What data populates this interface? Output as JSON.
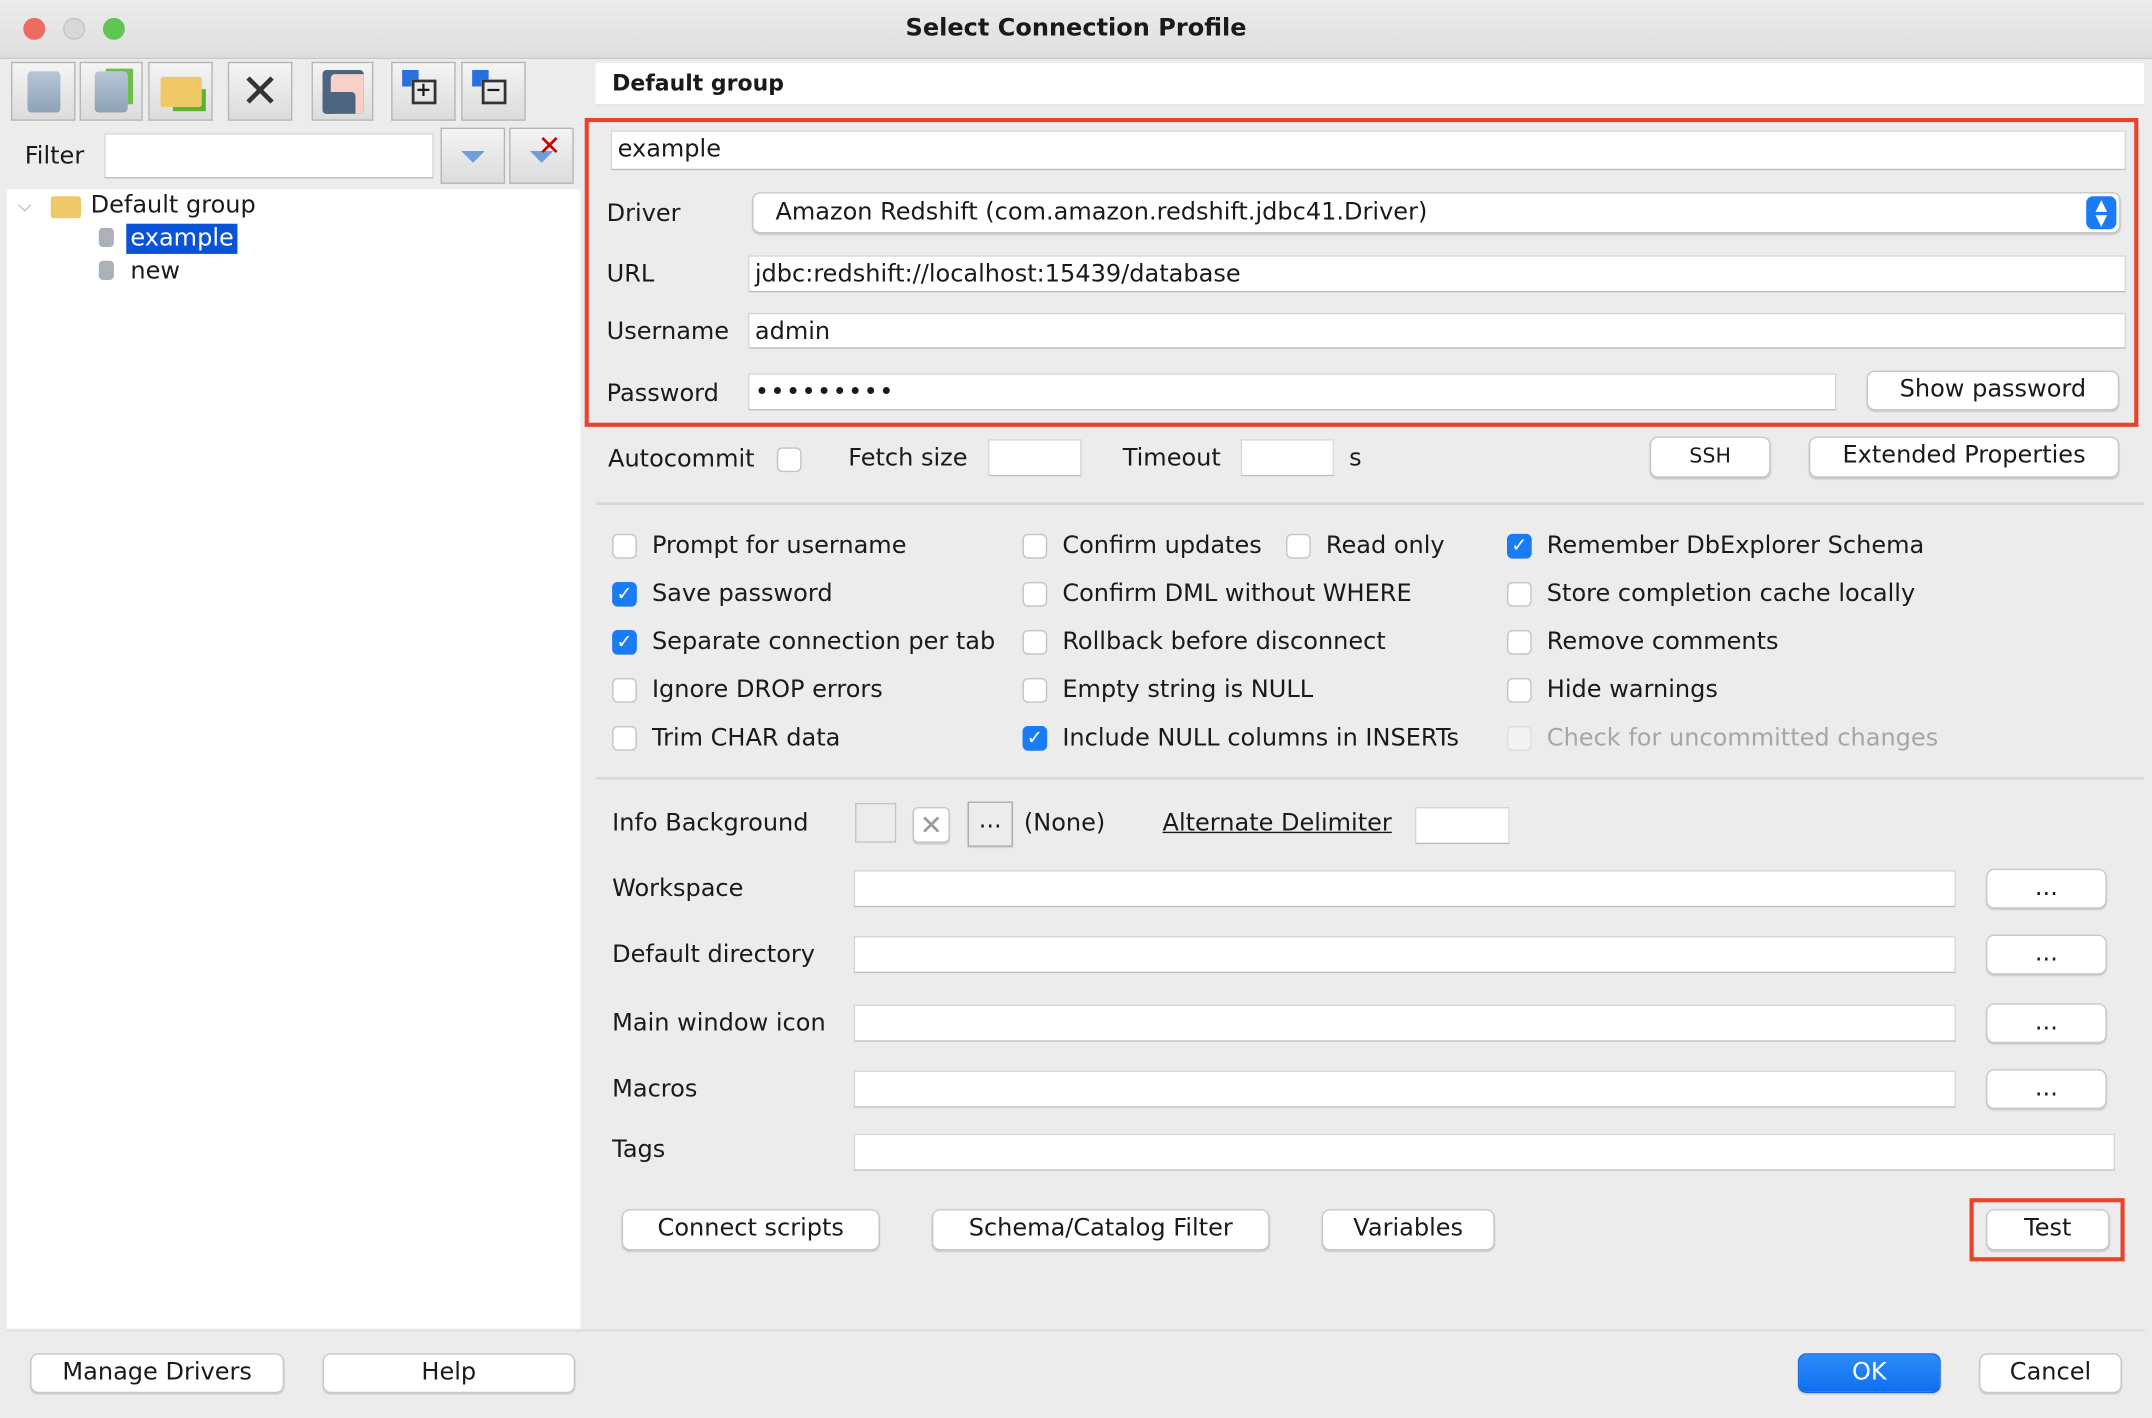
{
  "window": {
    "title": "Select Connection Profile"
  },
  "sidebar": {
    "filter_label": "Filter",
    "filter_value": "",
    "tree": {
      "group": "Default group",
      "items": [
        {
          "label": "example",
          "selected": true
        },
        {
          "label": "new",
          "selected": false
        }
      ]
    },
    "toolbar_icons": [
      "new-profile-icon",
      "copy-profile-icon",
      "new-folder-icon",
      "delete-icon",
      "save-icon",
      "expand-tree-icon",
      "collapse-tree-icon"
    ]
  },
  "header": {
    "group_title": "Default group"
  },
  "profile": {
    "name": "example",
    "driver_label": "Driver",
    "driver_value": "Amazon Redshift (com.amazon.redshift.jdbc41.Driver)",
    "url_label": "URL",
    "url_value": "jdbc:redshift://localhost:15439/database",
    "username_label": "Username",
    "username_value": "admin",
    "password_label": "Password",
    "password_value": "•••••••••",
    "show_password": "Show password"
  },
  "options": {
    "autocommit": "Autocommit",
    "fetch_size": "Fetch size",
    "timeout": "Timeout",
    "timeout_unit": "s",
    "ssh": "SSH",
    "extended_properties": "Extended Properties"
  },
  "checkboxes": [
    {
      "label": "Prompt for username",
      "checked": false
    },
    {
      "label": "Save password",
      "checked": true
    },
    {
      "label": "Separate connection per tab",
      "checked": true
    },
    {
      "label": "Ignore DROP errors",
      "checked": false
    },
    {
      "label": "Trim CHAR data",
      "checked": false
    },
    {
      "label": "Confirm updates",
      "checked": false
    },
    {
      "label": "Confirm DML without WHERE",
      "checked": false
    },
    {
      "label": "Rollback before disconnect",
      "checked": false
    },
    {
      "label": "Empty string is NULL",
      "checked": false
    },
    {
      "label": "Include NULL columns in INSERTs",
      "checked": true
    },
    {
      "label": "Read only",
      "checked": false
    },
    {
      "label": "Remember DbExplorer Schema",
      "checked": true
    },
    {
      "label": "Store completion cache locally",
      "checked": false
    },
    {
      "label": "Remove comments",
      "checked": false
    },
    {
      "label": "Hide warnings",
      "checked": false
    },
    {
      "label": "Check for uncommitted changes",
      "checked": false,
      "disabled": true
    }
  ],
  "extra": {
    "info_background": "Info Background",
    "info_browse": "...",
    "info_none": "(None)",
    "alternate_delimiter": "Alternate Delimiter",
    "workspace": "Workspace",
    "default_directory": "Default directory",
    "main_window_icon": "Main window icon",
    "macros": "Macros",
    "tags": "Tags",
    "browse": "..."
  },
  "actions": {
    "connect_scripts": "Connect scripts",
    "schema_filter": "Schema/Catalog Filter",
    "variables": "Variables",
    "test": "Test"
  },
  "footer": {
    "manage_drivers": "Manage Drivers",
    "help": "Help",
    "ok": "OK",
    "cancel": "Cancel"
  },
  "colors": {
    "accent": "#1a7cf5",
    "highlight": "#e8432a",
    "selection": "#0a53d6"
  }
}
